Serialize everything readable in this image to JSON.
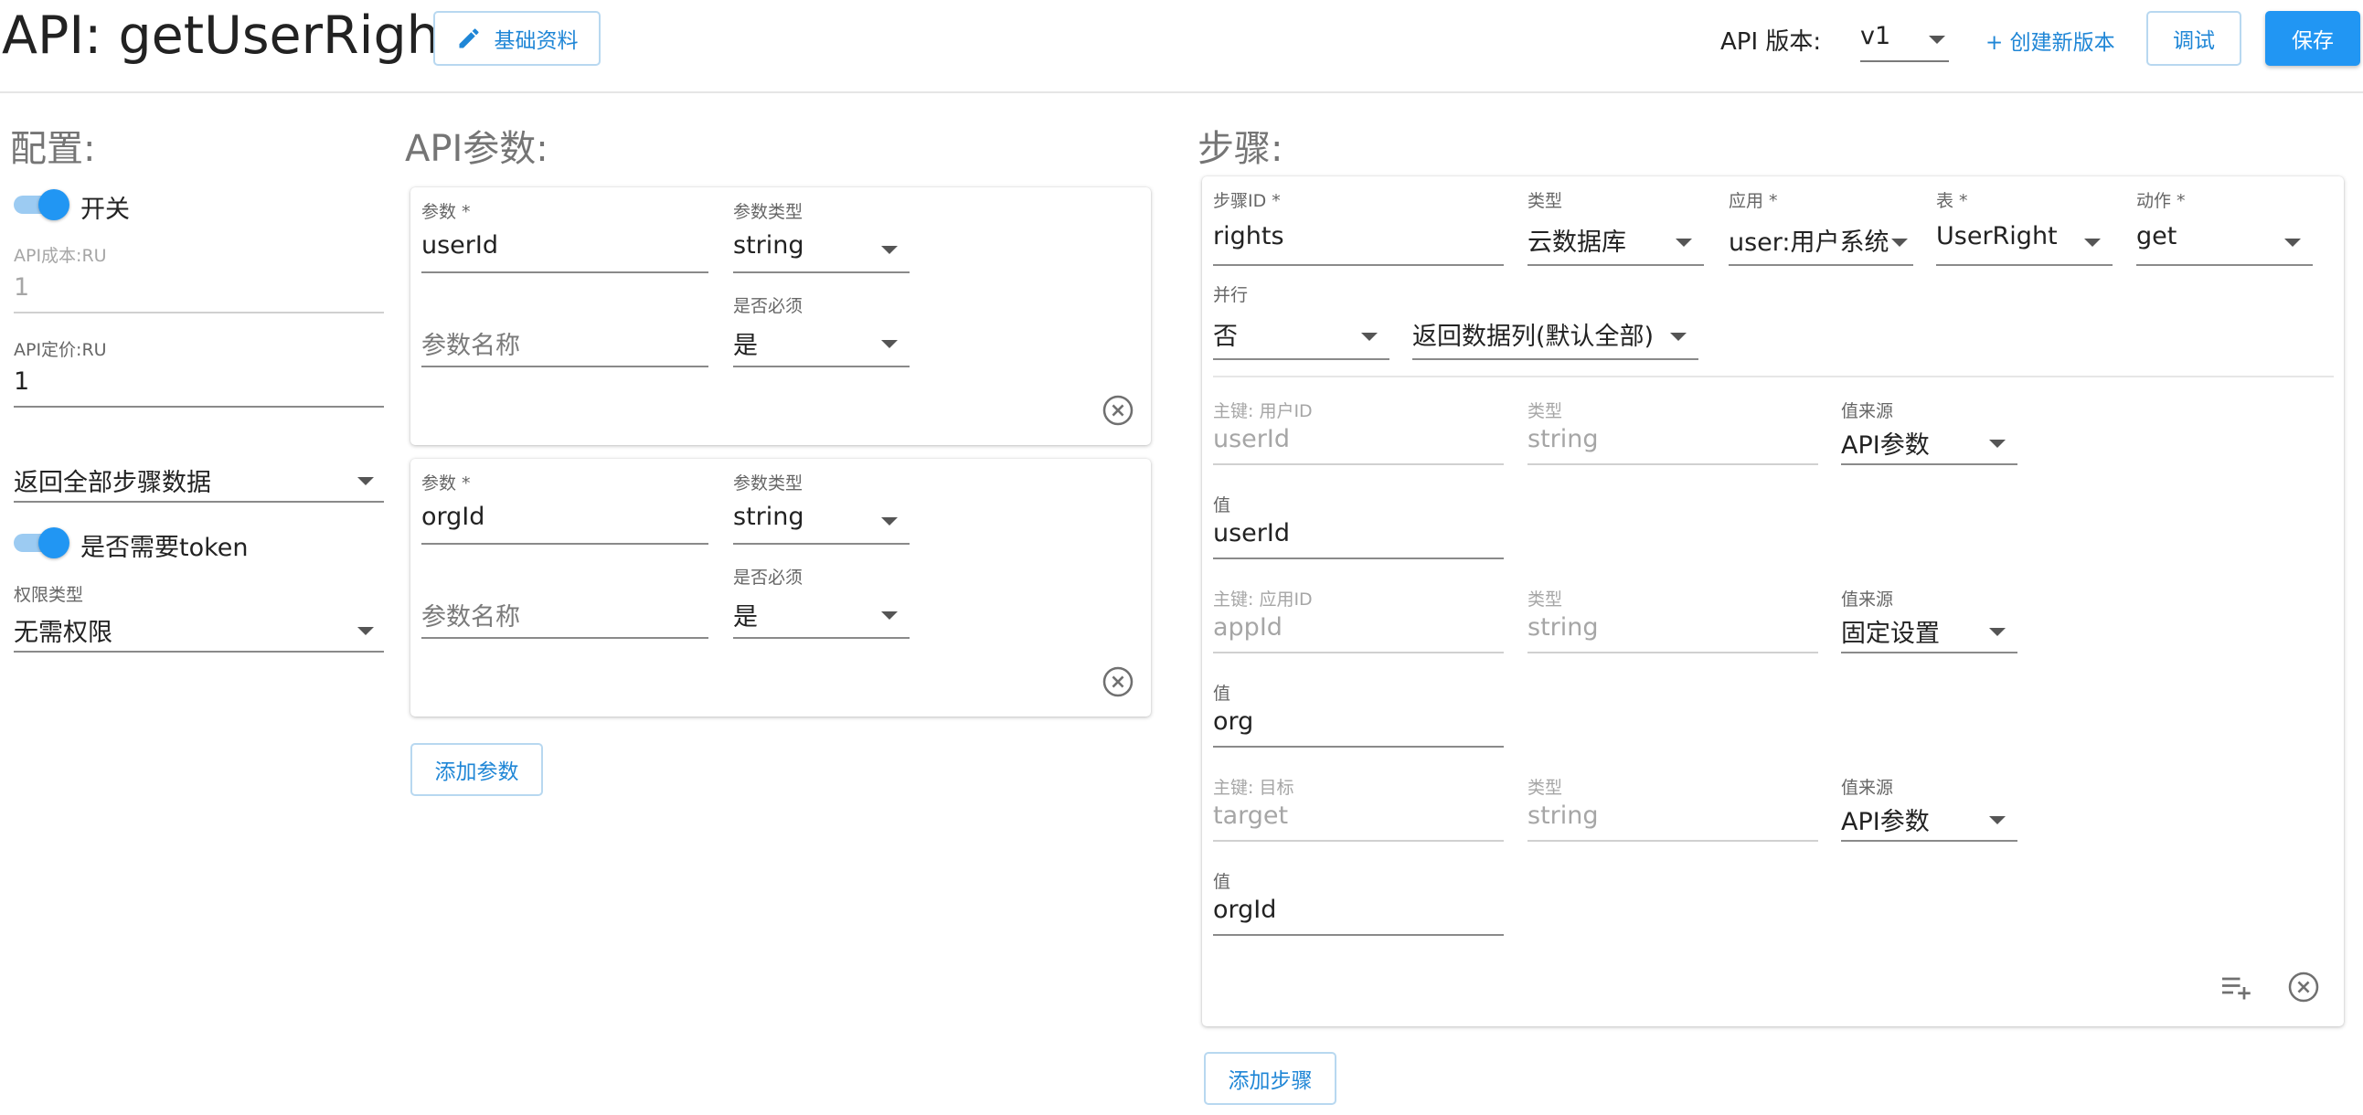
{
  "header": {
    "title": "API: getUserRight",
    "info_button": "基础资料",
    "version_label": "API 版本:",
    "version_value": "v1",
    "new_version": "+ 创建新版本",
    "debug_button": "调试",
    "save_button": "保存"
  },
  "config": {
    "section_title": "配置:",
    "switch_label": "开关",
    "cost_label": "API成本:RU",
    "cost_value": "1",
    "price_label": "API定价:RU",
    "price_value": "1",
    "return_select": "返回全部步骤数据",
    "token_label": "是否需要token",
    "permission_label": "权限类型",
    "permission_value": "无需权限"
  },
  "params": {
    "section_title": "API参数:",
    "add_button": "添加参数",
    "items": [
      {
        "param_label": "参数 *",
        "param_value": "userId",
        "type_label": "参数类型",
        "type_value": "string",
        "name_placeholder": "参数名称",
        "required_label": "是否必须",
        "required_value": "是"
      },
      {
        "param_label": "参数 *",
        "param_value": "orgId",
        "type_label": "参数类型",
        "type_value": "string",
        "name_placeholder": "参数名称",
        "required_label": "是否必须",
        "required_value": "是"
      }
    ]
  },
  "steps": {
    "section_title": "步骤:",
    "add_button": "添加步骤",
    "step": {
      "id_label": "步骤ID *",
      "id_value": "rights",
      "type_label": "类型",
      "type_value": "云数据库",
      "app_label": "应用 *",
      "app_value": "user:用户系统",
      "table_label": "表 *",
      "table_value": "UserRight",
      "action_label": "动作 *",
      "action_value": "get",
      "parallel_label": "并行",
      "parallel_value": "否",
      "return_columns": "返回数据列(默认全部)",
      "keys": [
        {
          "key_label": "主键: 用户ID",
          "key_value": "userId",
          "type_label": "类型",
          "type_value": "string",
          "source_label": "值来源",
          "source_value": "API参数",
          "value_label": "值",
          "value_value": "userId"
        },
        {
          "key_label": "主键: 应用ID",
          "key_value": "appId",
          "type_label": "类型",
          "type_value": "string",
          "source_label": "值来源",
          "source_value": "固定设置",
          "value_label": "值",
          "value_value": "org"
        },
        {
          "key_label": "主键: 目标",
          "key_value": "target",
          "type_label": "类型",
          "type_value": "string",
          "source_label": "值来源",
          "source_value": "API参数",
          "value_label": "值",
          "value_value": "orgId"
        }
      ]
    }
  },
  "colors": {
    "accent": "#2196f3",
    "link": "#1f86d6",
    "toggle_track": "#9ccbf2"
  }
}
